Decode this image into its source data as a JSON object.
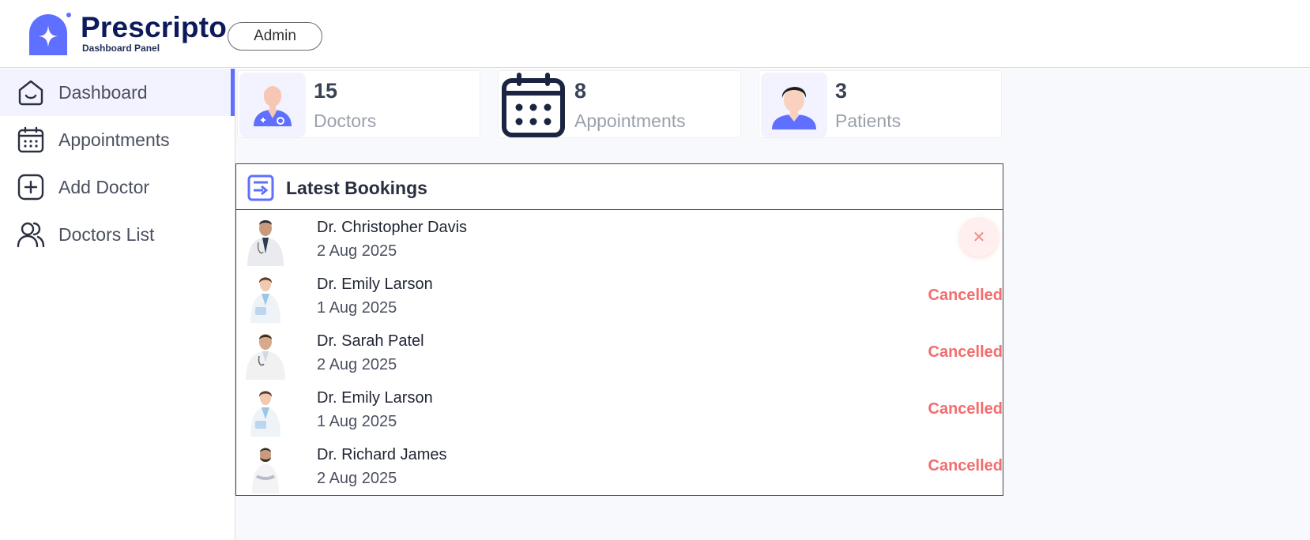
{
  "header": {
    "brand": "Prescripto",
    "subtitle": "Dashboard Panel",
    "role": "Admin",
    "logo_icon": "sparkle-logo-icon"
  },
  "sidebar": {
    "items": [
      {
        "label": "Dashboard",
        "icon": "home-icon",
        "active": true
      },
      {
        "label": "Appointments",
        "icon": "calendar-icon",
        "active": false
      },
      {
        "label": "Add Doctor",
        "icon": "add-square-icon",
        "active": false
      },
      {
        "label": "Doctors List",
        "icon": "people-icon",
        "active": false
      }
    ]
  },
  "stats": [
    {
      "value": "15",
      "label": "Doctors",
      "icon": "doctor-icon"
    },
    {
      "value": "8",
      "label": "Appointments",
      "icon": "calendar-icon"
    },
    {
      "value": "3",
      "label": "Patients",
      "icon": "patient-icon"
    }
  ],
  "latest": {
    "title": "Latest Bookings",
    "icon": "list-icon",
    "rows": [
      {
        "name": "Dr. Christopher Davis",
        "date": "2 Aug 2025",
        "status": "",
        "action": "cancel-icon"
      },
      {
        "name": "Dr. Emily Larson",
        "date": "1 Aug 2025",
        "status": "Cancelled"
      },
      {
        "name": "Dr. Sarah Patel",
        "date": "2 Aug 2025",
        "status": "Cancelled"
      },
      {
        "name": "Dr. Emily Larson",
        "date": "1 Aug 2025",
        "status": "Cancelled"
      },
      {
        "name": "Dr. Richard James",
        "date": "2 Aug 2025",
        "status": "Cancelled"
      }
    ]
  },
  "colors": {
    "accent": "#5f6fff",
    "brand_text": "#0c1a5b",
    "cancelled": "#f26d6d",
    "active_bg": "#f2f3ff"
  }
}
